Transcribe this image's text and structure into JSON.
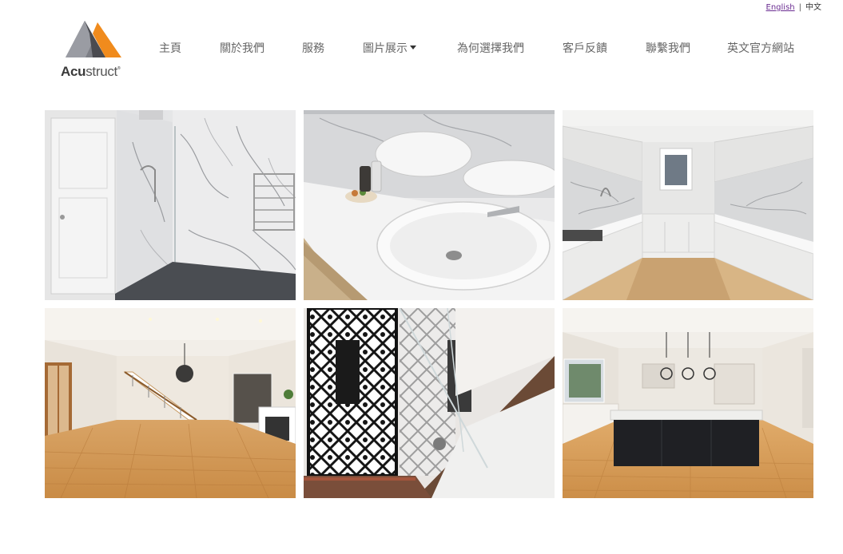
{
  "lang": {
    "english": "English",
    "separator": "|",
    "chinese": "中文"
  },
  "logo": {
    "brand_bold": "Acu",
    "brand_light": "struct",
    "mark": "®",
    "colors": {
      "grey": "#7d7f86",
      "orange": "#f08b1d",
      "dark": "#4a4b50"
    }
  },
  "nav": {
    "items": [
      {
        "label": "主頁"
      },
      {
        "label": "關於我們"
      },
      {
        "label": "服務"
      },
      {
        "label": "圖片展示",
        "has_dropdown": true
      },
      {
        "label": "為何選擇我們"
      },
      {
        "label": "客戶反饋"
      },
      {
        "label": "聯繫我們"
      },
      {
        "label": "英文官方網站"
      }
    ]
  },
  "gallery": {
    "photos": [
      {
        "subject": "bathroom-shower"
      },
      {
        "subject": "bathroom-vanity-basin"
      },
      {
        "subject": "kitchen-white-cabinets"
      },
      {
        "subject": "living-room-staircase-chandelier"
      },
      {
        "subject": "screen-panel-glass-staircase"
      },
      {
        "subject": "kitchen-island-pendant-lights"
      }
    ]
  }
}
